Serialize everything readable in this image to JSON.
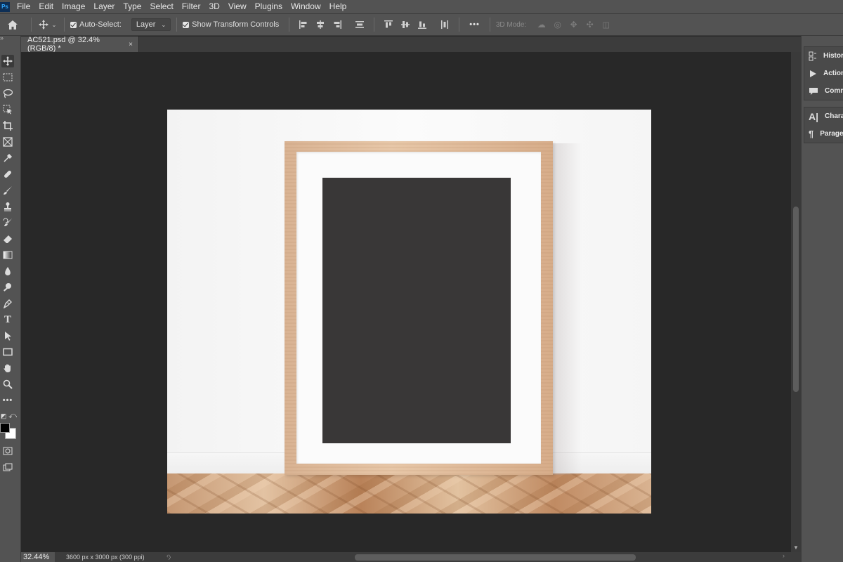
{
  "app": {
    "logo": "Ps"
  },
  "menu": [
    "File",
    "Edit",
    "Image",
    "Layer",
    "Type",
    "Select",
    "Filter",
    "3D",
    "View",
    "Plugins",
    "Window",
    "Help"
  ],
  "options_bar": {
    "auto_select_label": "Auto-Select:",
    "auto_select_checked": true,
    "auto_select_target": "Layer",
    "transform_controls_label": "Show Transform Controls",
    "transform_controls_checked": true,
    "more_label": "•••",
    "mode_3d_label": "3D Mode:"
  },
  "document_tab": {
    "title": "AC521.psd @ 32.4% (RGB/8) *",
    "close": "×"
  },
  "tools": [
    "move-icon",
    "marquee-icon",
    "lasso-icon",
    "object-select-icon",
    "crop-icon",
    "frame-icon",
    "eyedropper-icon",
    "healing-brush-icon",
    "brush-icon",
    "stamp-icon",
    "history-brush-icon",
    "eraser-icon",
    "gradient-icon",
    "blur-icon",
    "dodge-icon",
    "pen-icon",
    "type-icon",
    "path-select-icon",
    "rectangle-icon",
    "hand-icon",
    "zoom-icon",
    "more-tools-icon"
  ],
  "colors": {
    "foreground": "#000000",
    "background": "#ffffff",
    "artwork": "#393737",
    "chrome": "#535353",
    "canvas_bg": "#282828"
  },
  "panels": [
    {
      "label": "Histor",
      "icon": "history-icon"
    },
    {
      "label": "Action",
      "icon": "actions-icon"
    },
    {
      "label": "Comm",
      "icon": "comments-icon"
    },
    {
      "label": "Charac",
      "icon": "character-icon"
    },
    {
      "label": "Parage",
      "icon": "paragraph-icon"
    }
  ],
  "status": {
    "zoom": "32.44%",
    "doc_info": "3600 px x 3000 px (300 ppi)",
    "arrow": "〉"
  }
}
